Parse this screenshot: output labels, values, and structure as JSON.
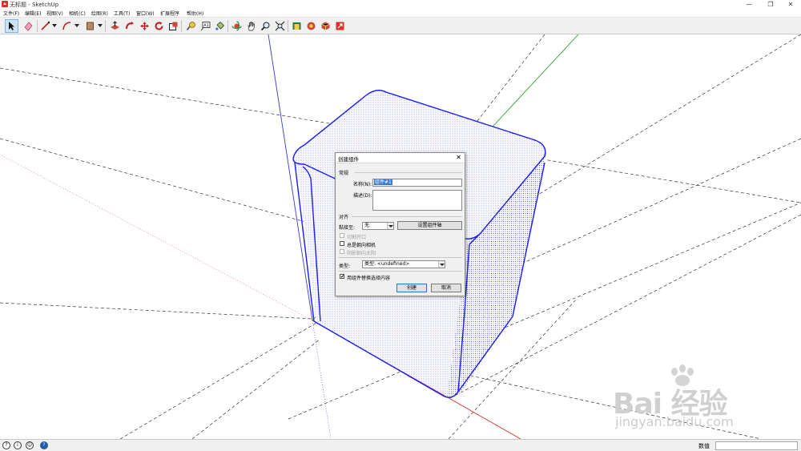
{
  "window": {
    "title": "无标题 - SketchUp",
    "minimize_glyph": "—",
    "restore_glyph": "❐",
    "close_glyph": "✕"
  },
  "menu": [
    "文件(F)",
    "编辑(E)",
    "视图(V)",
    "相机(C)",
    "绘图(R)",
    "工具(T)",
    "窗口(W)",
    "扩展程序",
    "帮助(H)"
  ],
  "toolbar": {
    "icons": [
      "select-icon",
      "eraser-icon",
      "line-icon",
      "arc-icon",
      "rectangle-icon",
      "push-pull-icon",
      "move-icon",
      "rotate-icon",
      "scale-icon",
      "offset-icon",
      "tape-measure-icon",
      "text-icon",
      "paint-bucket-icon",
      "orbit-icon",
      "pan-icon",
      "zoom-icon",
      "zoom-extents-icon",
      "warehouse-icon",
      "extension-warehouse-icon",
      "send-to-layout-icon"
    ],
    "accent": "#7fb2e5"
  },
  "dialog": {
    "title": "创建组件",
    "close_glyph": "✕",
    "general_section": "常规",
    "name_label": "名称(N):",
    "name_value": "组件#1",
    "description_label": "描述(D):",
    "description_value": "",
    "alignment_section": "对齐",
    "glue_to_label": "黏接至:",
    "glue_to_value": "无",
    "set_axes_button": "设置组件轴",
    "cut_opening_label": "切割开口",
    "always_face_camera_label": "总是朝向相机",
    "shadows_face_sun_label": "阴影朝向太阳",
    "type_label": "类型:",
    "type_value": "类型: <undefined>",
    "replace_selection_label": "用组件替换选择内容",
    "replace_selection_checked": "✔",
    "create_button": "创建",
    "cancel_button": "取消"
  },
  "statusbar": {
    "measurements_label": "数值",
    "measurements_value": ""
  },
  "watermark": {
    "main": "Bai 经验",
    "url": "jingyan.baidu.com"
  },
  "colors": {
    "selection_edge": "#1a1aff",
    "axis_red": "#d23232",
    "axis_green": "#2ea02e",
    "axis_blue": "#3232d2"
  }
}
